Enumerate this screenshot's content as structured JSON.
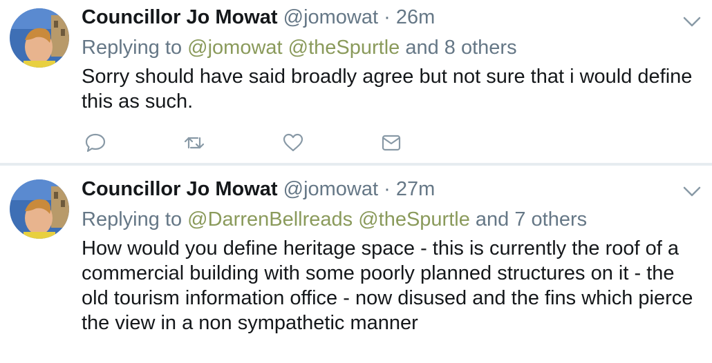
{
  "tweets": [
    {
      "author_name": "Councillor Jo Mowat",
      "handle": "@jomowat",
      "separator": "·",
      "time": "26m",
      "replying_prefix": "Replying to",
      "mentions": [
        "@jomowat",
        "@theSpurtle"
      ],
      "replying_suffix": "and 8 others",
      "text": "Sorry should have said broadly agree but not sure that i would define this as such.",
      "actions": [
        "reply-icon",
        "retweet-icon",
        "like-icon",
        "direct-message-icon"
      ]
    },
    {
      "author_name": "Councillor Jo Mowat",
      "handle": "@jomowat",
      "separator": "·",
      "time": "27m",
      "replying_prefix": "Replying to",
      "mentions": [
        "@DarrenBellreads",
        "@theSpurtle"
      ],
      "replying_suffix": "and 7 others",
      "text": "How would you define heritage space - this is currently the roof of a commercial building with some poorly planned structures on it - the old tourism information office - now disused and the fins which pierce the view in a non sympathetic manner"
    }
  ],
  "colors": {
    "text": "#14171a",
    "secondary": "#657786",
    "mention": "#8a9a5b",
    "divider": "#e6ecf0",
    "icon": "#8899a6"
  }
}
